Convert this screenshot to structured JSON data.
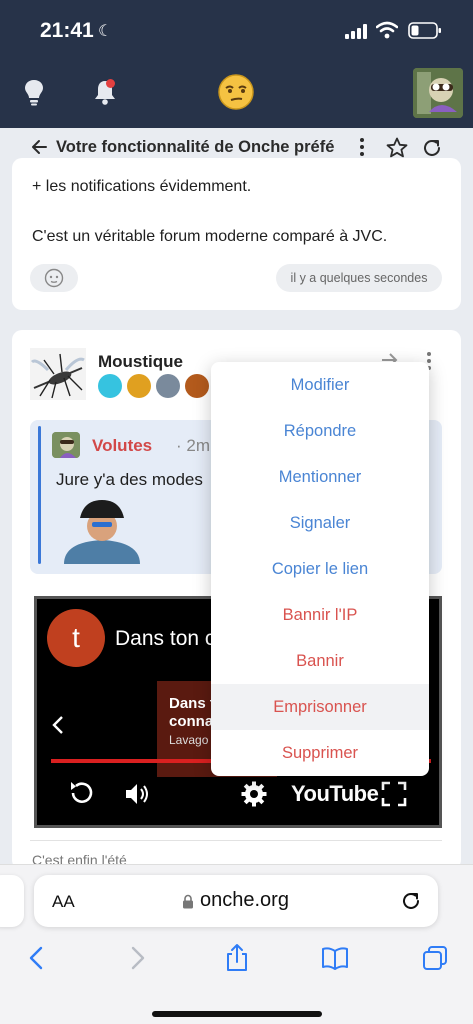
{
  "status_bar": {
    "time": "21:41"
  },
  "header": {
    "logo": "onche-smiley-logo"
  },
  "breadcrumb": {
    "title": "Votre fonctionnalité de Onche préfé"
  },
  "prev_message": {
    "line1": "+ les notifications évidemment.",
    "line2": "C'est un véritable forum moderne comparé à JVC.",
    "timestamp": "il y a quelques secondes"
  },
  "post": {
    "author": "Moustique",
    "quote": {
      "author": "Volutes",
      "time": "· 2m",
      "text": "Jure y'a des modes"
    },
    "video": {
      "channel_initial": "t",
      "title": "Dans ton c",
      "thumb_line1": "Dans t",
      "thumb_line2": "conna",
      "thumb_line3": "Lavago",
      "youtube_label": "YouTube"
    },
    "next_text": "C'est enfin l'été"
  },
  "context_menu": {
    "items": [
      {
        "label": "Modifier",
        "tone": "blue"
      },
      {
        "label": "Répondre",
        "tone": "blue"
      },
      {
        "label": "Mentionner",
        "tone": "blue"
      },
      {
        "label": "Signaler",
        "tone": "blue"
      },
      {
        "label": "Copier le lien",
        "tone": "blue"
      },
      {
        "label": "Bannir l'IP",
        "tone": "red"
      },
      {
        "label": "Bannir",
        "tone": "red"
      },
      {
        "label": "Emprisonner",
        "tone": "red",
        "highlighted": true
      },
      {
        "label": "Supprimer",
        "tone": "red"
      }
    ]
  },
  "safari": {
    "aa_label": "AA",
    "url": "onche.org"
  },
  "colors": {
    "header_bg": "#273349",
    "accent_blue": "#4a85d4",
    "danger_red": "#d9534f",
    "quote_author": "#d24848"
  }
}
